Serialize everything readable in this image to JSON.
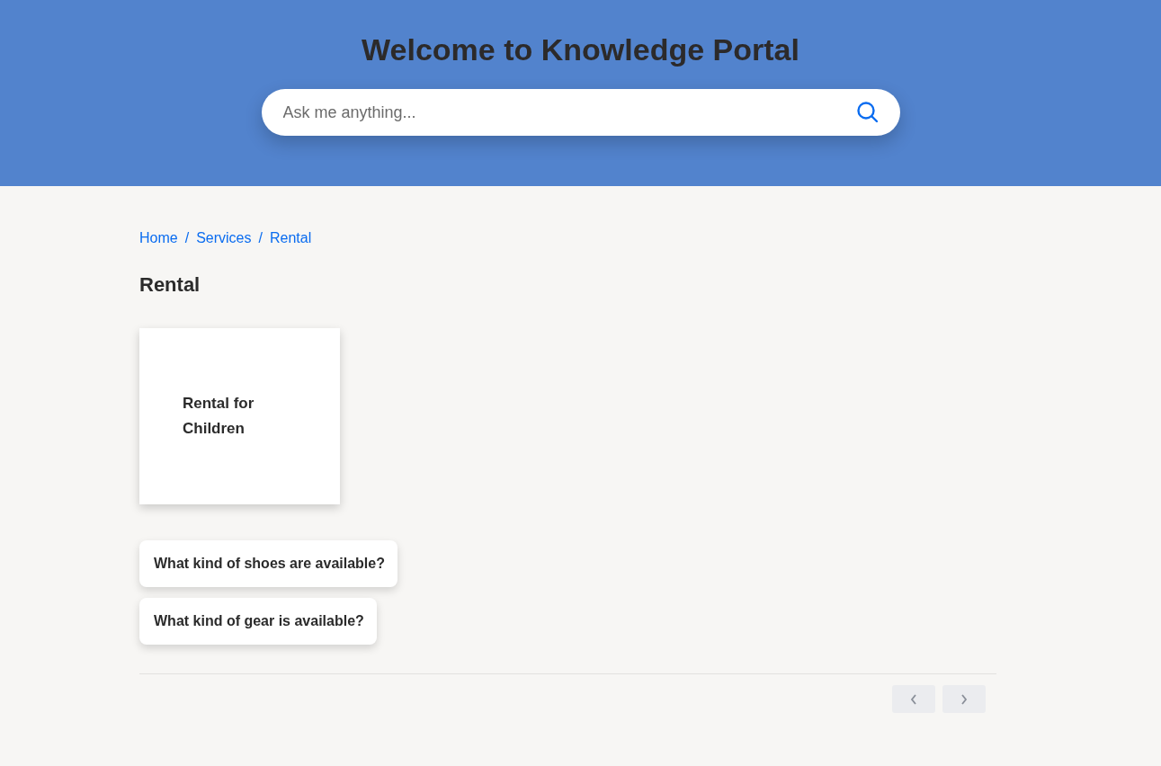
{
  "header": {
    "title": "Welcome to Knowledge Portal",
    "search": {
      "placeholder": "Ask me anything..."
    }
  },
  "breadcrumb": [
    "Home",
    "Services",
    "Rental"
  ],
  "separator": "/",
  "heading": "Rental",
  "cards": [
    {
      "title": "Rental for Children"
    }
  ],
  "questions": [
    "What kind of shoes are available?",
    "What kind of gear is available?"
  ],
  "pagination": {
    "previous_disabled": true,
    "next_disabled": true
  }
}
